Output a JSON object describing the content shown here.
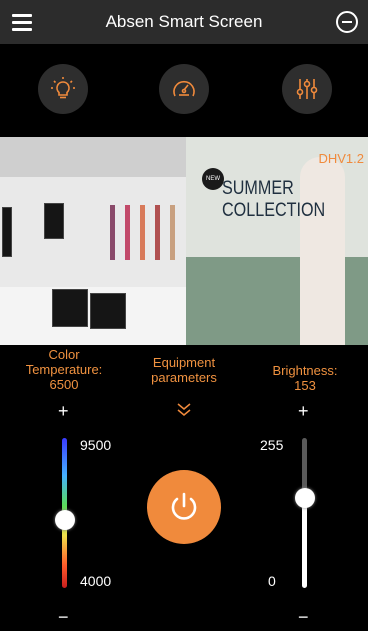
{
  "header": {
    "title": "Absen Smart Screen"
  },
  "toolbar": {
    "buttons": [
      {
        "icon": "lightbulb-icon"
      },
      {
        "icon": "speedometer-icon"
      },
      {
        "icon": "sliders-icon"
      }
    ]
  },
  "preview": {
    "badge": "NEW",
    "headline_1": "SUMMER",
    "headline_2": "COLLECTION",
    "version": "DHV1.2"
  },
  "controls": {
    "color_temp_label_1": "Color",
    "color_temp_label_2": "Temperature:",
    "color_temp_value": "6500",
    "equipment_label_1": "Equipment",
    "equipment_label_2": "parameters",
    "brightness_label": "Brightness:",
    "brightness_value": "153",
    "plus": "+",
    "minus": "−",
    "color_max": "9500",
    "color_min": "4000",
    "bright_max": "255",
    "bright_min": "0",
    "color_temp_level": 6500,
    "brightness_level": 153
  },
  "colors": {
    "accent": "#f08a3c",
    "header_bg": "#2c2c2c",
    "button_bg": "#2e2e2e"
  }
}
